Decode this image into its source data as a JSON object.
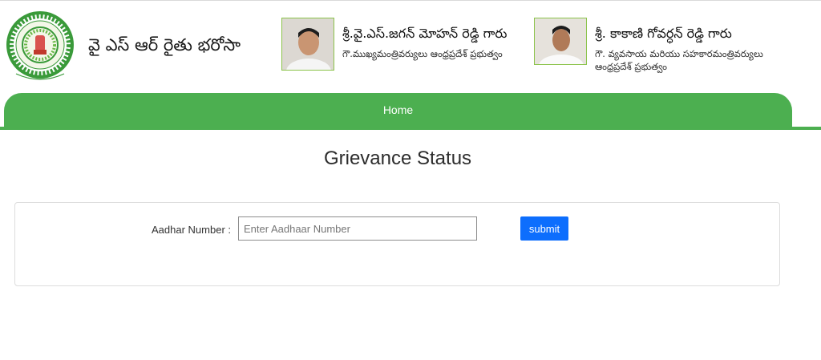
{
  "header": {
    "emblem_icon": "andhra-pradesh-emblem-icon",
    "site_title": "వై ఎస్ ఆర్ రైతు భరోసా",
    "chief_minister": {
      "name": "శ్రీ.వై.ఎస్.జగన్ మోహన్ రెడ్డి గారు",
      "designation": "గౌ.ముఖ్యమంత్రివర్యులు ఆంధ్రప్రదేశ్ ప్రభుత్వం"
    },
    "minister": {
      "name": "శ్రీ. కాకాణి గోవర్ధన్ రెడ్డి గారు",
      "designation_line1": "గౌ. వ్యవసాయ మరియు సహకారమంత్రివర్యులు",
      "designation_line2": "ఆంధ్రప్రదేశ్ ప్రభుత్వం"
    }
  },
  "nav": {
    "home_label": "Home"
  },
  "main": {
    "page_title": "Grievance Status",
    "form": {
      "aadhar_label": "Aadhar Number :",
      "aadhar_placeholder": "Enter Aadhaar Number",
      "aadhar_value": "",
      "submit_label": "submit"
    }
  },
  "colors": {
    "nav_green": "#4caf50",
    "submit_blue": "#0d6efd"
  }
}
